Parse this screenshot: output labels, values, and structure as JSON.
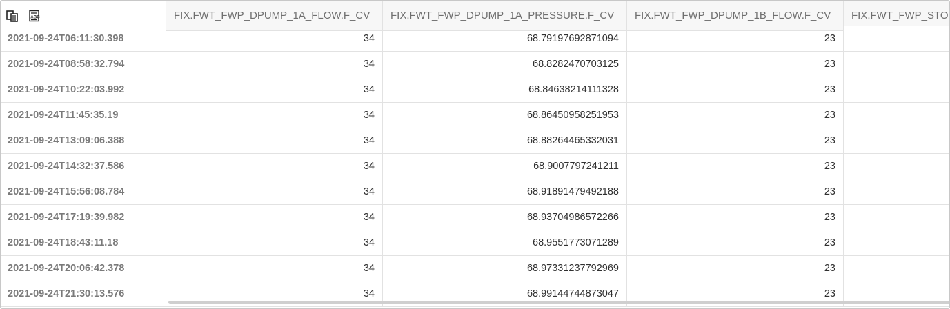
{
  "toolbar": {
    "icons": [
      "copy-table-icon",
      "text-export-icon"
    ]
  },
  "columns": [
    "FIX.FWT_FWP_DPUMP_1A_FLOW.F_CV",
    "FIX.FWT_FWP_DPUMP_1A_PRESSURE.F_CV",
    "FIX.FWT_FWP_DPUMP_1B_FLOW.F_CV",
    "FIX.FWT_FWP_STO"
  ],
  "rows": [
    {
      "ts": "2021-09-24T06:11:30.398",
      "c1": "34",
      "c2": "68.79197692871094",
      "c3": "23"
    },
    {
      "ts": "2021-09-24T08:58:32.794",
      "c1": "34",
      "c2": "68.8282470703125",
      "c3": "23"
    },
    {
      "ts": "2021-09-24T10:22:03.992",
      "c1": "34",
      "c2": "68.84638214111328",
      "c3": "23"
    },
    {
      "ts": "2021-09-24T11:45:35.19",
      "c1": "34",
      "c2": "68.86450958251953",
      "c3": "23"
    },
    {
      "ts": "2021-09-24T13:09:06.388",
      "c1": "34",
      "c2": "68.88264465332031",
      "c3": "23"
    },
    {
      "ts": "2021-09-24T14:32:37.586",
      "c1": "34",
      "c2": "68.9007797241211",
      "c3": "23"
    },
    {
      "ts": "2021-09-24T15:56:08.784",
      "c1": "34",
      "c2": "68.91891479492188",
      "c3": "23"
    },
    {
      "ts": "2021-09-24T17:19:39.982",
      "c1": "34",
      "c2": "68.93704986572266",
      "c3": "23"
    },
    {
      "ts": "2021-09-24T18:43:11.18",
      "c1": "34",
      "c2": "68.9551773071289",
      "c3": "23"
    },
    {
      "ts": "2021-09-24T20:06:42.378",
      "c1": "34",
      "c2": "68.97331237792969",
      "c3": "23"
    },
    {
      "ts": "2021-09-24T21:30:13.576",
      "c1": "34",
      "c2": "68.99144744873047",
      "c3": "23"
    }
  ]
}
